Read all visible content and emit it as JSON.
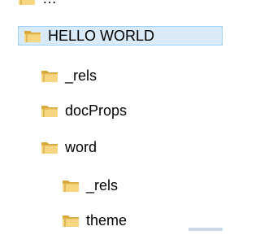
{
  "tree": {
    "clipped_item": {
      "label": "…",
      "icon": "folder-icon"
    },
    "items": [
      {
        "label": "HELLO WORLD",
        "icon": "folder-icon",
        "selected": true
      },
      {
        "label": "_rels",
        "icon": "folder-icon",
        "selected": false
      },
      {
        "label": "docProps",
        "icon": "folder-icon",
        "selected": false
      },
      {
        "label": "word",
        "icon": "folder-icon",
        "selected": false
      },
      {
        "label": "_rels",
        "icon": "folder-icon",
        "selected": false
      },
      {
        "label": "theme",
        "icon": "folder-icon",
        "selected": false
      }
    ]
  },
  "colors": {
    "selection_bg": "#d9ebf9",
    "selection_border": "#99d1ff",
    "folder_light": "#f6d680",
    "folder_dark": "#d9a83a"
  }
}
